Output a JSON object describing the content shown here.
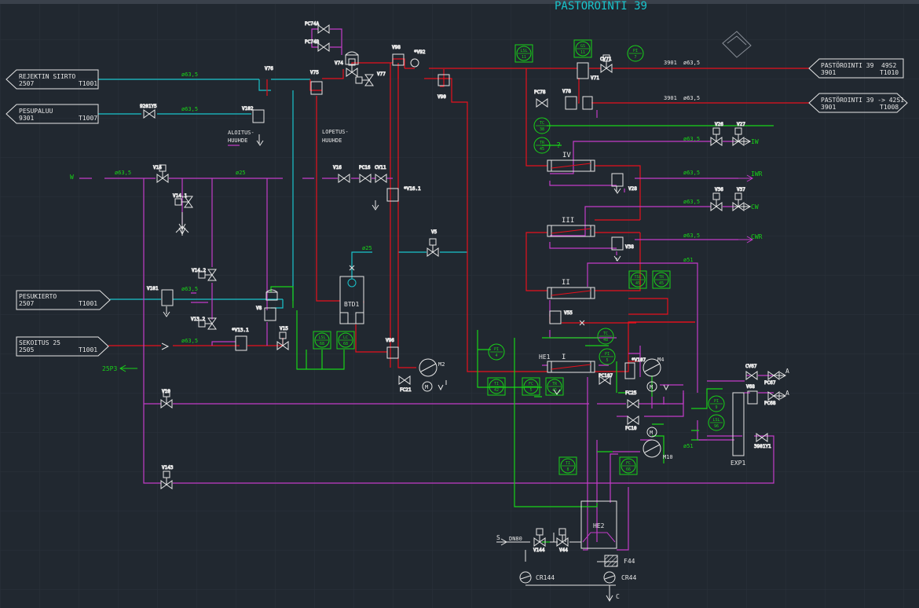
{
  "title": "PASTÖROINTI 39",
  "colors": {
    "background": "#212830",
    "grid": "#2b323b",
    "red": "#e8101c",
    "magenta": "#c23cc8",
    "cyan": "#19c4cc",
    "green": "#18d418",
    "white": "#e6e6e6"
  },
  "offpage": {
    "rejektin": {
      "name": "REJEKTIN SIIRTO",
      "code": "2507",
      "ref": "T1001"
    },
    "pesupaluu": {
      "name": "PESUPALUU",
      "code": "9301",
      "ref": "T1007"
    },
    "pesukierto": {
      "name": "PESUKIERTO",
      "code": "2507",
      "ref": "T1001"
    },
    "sekoitus": {
      "name": "SEKOITUS 25",
      "code": "2505",
      "ref": "T1001"
    },
    "past1": {
      "name": "PASTÖROINTI 39",
      "num": "49S2",
      "code": "3901",
      "ref": "T1010"
    },
    "past2": {
      "name": "PASTÖROINTI 39 -> 42S1",
      "code": "3901",
      "ref": "T1008"
    }
  },
  "valves": {
    "pc74a": "PC74A",
    "pc74b": "PC74B",
    "v74": "V74",
    "v77": "V77",
    "v98": "V98",
    "v92": "*V92",
    "v90": "V90",
    "cv71": "CV71",
    "v71": "V71",
    "pc78": "PC78",
    "v78": "V78",
    "v76": "V76",
    "v75": "V75",
    "v102": "V102",
    "v9201y5": "9201Y5",
    "v14": "V14",
    "v14_1": "V14.1",
    "v14_2": "V14.2",
    "v13_2": "V13.2",
    "v13_1": "*V13.1",
    "v15": "V15",
    "v8": "V8",
    "v101": "V101",
    "v16": "V16",
    "pc16": "PC16",
    "cv11": "CV11",
    "v16_1": "*V16.1",
    "v5": "V5",
    "v96": "V96",
    "fc21": "FC21",
    "v26": "V26",
    "v27": "V27",
    "v28": "V28",
    "v36": "V36",
    "v37": "V37",
    "v38": "V38",
    "v55": "V55",
    "pc107": "PC107",
    "v107": "*V107",
    "fc25": "FC25",
    "fc10": "FC10",
    "cv67": "CV67",
    "pc67": "PC67",
    "v68": "V68",
    "pc68": "PC68",
    "v3901y1": "3901Y1",
    "v10": "V10",
    "v143": "V143",
    "v144": "V144",
    "v44": "V44"
  },
  "labels": {
    "aloitus": "ALOITUS-",
    "huuhde1": "HUUHDE",
    "lopetus": "LOPETUS-",
    "huuhde2": "HUUHDE",
    "btd1": "BTD1",
    "m2": "M2",
    "m4": "M4",
    "m10": "M10",
    "he1": "HE1",
    "he2": "HE2",
    "exp1": "EXP1",
    "f44": "F44",
    "cr144": "CR144",
    "cr44": "CR44",
    "p25p3": "25P3",
    "w": "W",
    "iw": "IW",
    "iwr": "IWR",
    "cw": "CW",
    "cwr": "CWR",
    "a1": "A",
    "a2": "A",
    "s": "S",
    "c": "C",
    "dn80": "DN80",
    "hx4": "IV",
    "hx3": "III",
    "hx2": "II",
    "hx1": "I",
    "q": "?",
    "s1": "3901",
    "s2": "3901"
  },
  "pipes": {
    "p1": "ø63,5",
    "p2": "ø63,5",
    "p3": "ø63,5",
    "p4": "ø25",
    "p5": "ø25",
    "p6": "ø63,5",
    "p7": "ø63,5",
    "p8": "ø63,5",
    "p9": "ø63,5",
    "p10": "ø63,5",
    "p11": "ø63,5",
    "p12": "ø63,5",
    "p13": "ø51",
    "p14": "ø51",
    "p15": "ø63,5",
    "p16": "ø63,5"
  },
  "instruments": {
    "lsl11": {
      "tag": "LSL",
      "num": "11"
    },
    "gs11": {
      "tag": "GS",
      "num": "11"
    },
    "pi7": {
      "tag": "PI",
      "num": "7"
    },
    "tc38": {
      "tag": "TC",
      "num": "38"
    },
    "tr45a": {
      "tag": "TR",
      "num": "45"
    },
    "lsl68": {
      "tag": "LSL",
      "num": "68"
    },
    "lc68": {
      "tag": "LC",
      "num": "68"
    },
    "tsl45": {
      "tag": "TSL",
      "num": "45"
    },
    "tr45b": {
      "tag": "TR",
      "num": "45"
    },
    "tc48": {
      "tag": "TC",
      "num": "48"
    },
    "pi4": {
      "tag": "PI",
      "num": "4"
    },
    "pi5": {
      "tag": "PI",
      "num": "5"
    },
    "ti42": {
      "tag": "TI",
      "num": "42"
    },
    "fc5": {
      "tag": "FC",
      "num": "5"
    },
    "tr45c": {
      "tag": "TR",
      "num": "45"
    },
    "pi9": {
      "tag": "PI",
      "num": "9"
    },
    "lsl96": {
      "tag": "LSL",
      "num": "96"
    },
    "ti8": {
      "tag": "TI",
      "num": "8"
    },
    "fc66": {
      "tag": "FC",
      "num": "66"
    }
  }
}
